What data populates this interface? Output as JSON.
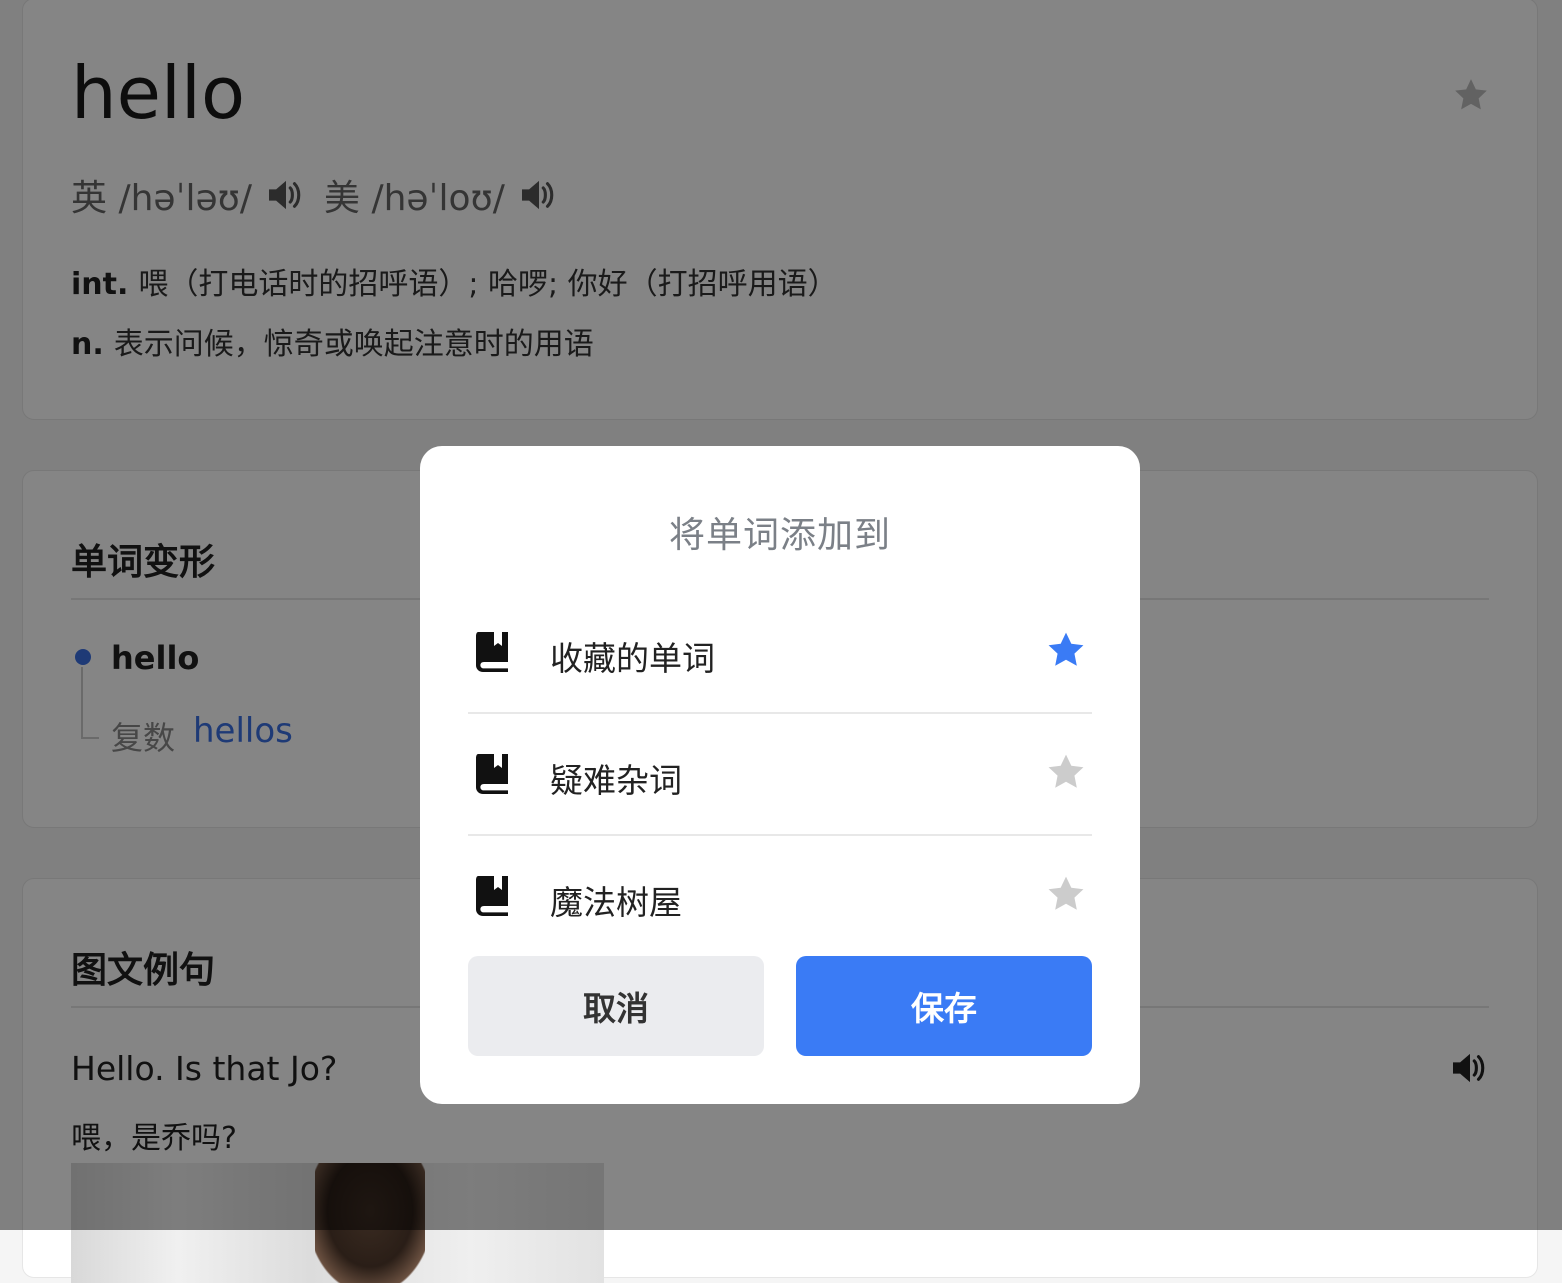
{
  "word": {
    "headword": "hello",
    "phonetics": [
      {
        "region": "英",
        "ipa": "/həˈləʊ/"
      },
      {
        "region": "美",
        "ipa": "/həˈloʊ/"
      }
    ],
    "definitions": [
      {
        "pos": "int.",
        "text": "喂（打电话时的招呼语）; 哈啰; 你好（打招呼用语）"
      },
      {
        "pos": "n.",
        "text": "表示问候，惊奇或唤起注意时的用语"
      }
    ]
  },
  "forms": {
    "title": "单词变形",
    "base": "hello",
    "label": "复数",
    "value": "hellos"
  },
  "examples": {
    "title": "图文例句",
    "en": "Hello. Is that Jo?",
    "zh": "喂，是乔吗?"
  },
  "modal": {
    "title": "将单词添加到",
    "options": [
      {
        "label": "收藏的单词",
        "starred": true
      },
      {
        "label": "疑难杂词",
        "starred": false
      },
      {
        "label": "魔法树屋",
        "starred": false
      }
    ],
    "cancel_label": "取消",
    "save_label": "保存"
  },
  "colors": {
    "accent": "#3a7bf5",
    "star_inactive": "#cccccc",
    "link": "#3b6fe3"
  }
}
